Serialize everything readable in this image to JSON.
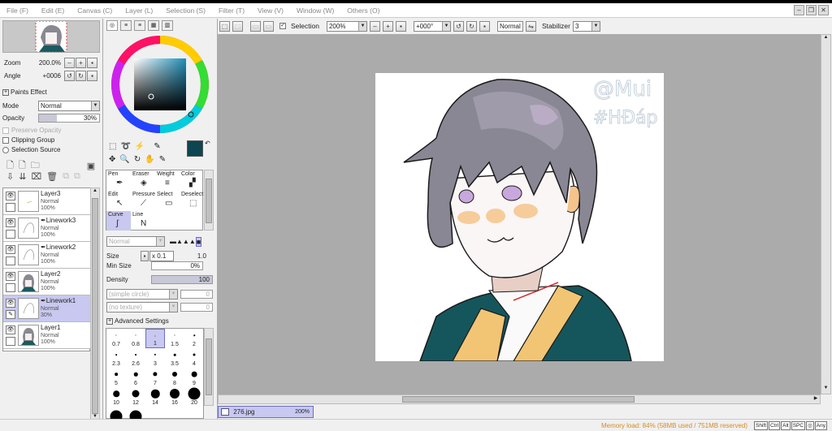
{
  "menu": [
    "File (F)",
    "Edit (E)",
    "Canvas (C)",
    "Layer (L)",
    "Selection (S)",
    "Filter (T)",
    "View (V)",
    "Window (W)",
    "Others (O)"
  ],
  "toolbar": {
    "selection_label": "Selection",
    "zoom": "200%",
    "angle": "+000°",
    "blend": "Normal",
    "stabilizer_label": "Stabilizer",
    "stabilizer_value": "3"
  },
  "navigator": {
    "zoom_label": "Zoom",
    "zoom_value": "200.0%",
    "angle_label": "Angle",
    "angle_value": "+0006"
  },
  "layer_props": {
    "paints_effect": "Paints Effect",
    "mode_label": "Mode",
    "mode_value": "Normal",
    "opacity_label": "Opacity",
    "opacity_value": "30%",
    "opacity_fraction": 0.3,
    "preserve_opacity": "Preserve Opacity",
    "clipping_group": "Clipping Group",
    "selection_source": "Selection Source"
  },
  "layers": [
    {
      "name": "Layer3",
      "mode": "Normal",
      "opacity": "100%",
      "linework": false,
      "active": false
    },
    {
      "name": "Linework3",
      "mode": "Normal",
      "opacity": "100%",
      "linework": true,
      "active": false
    },
    {
      "name": "Linework2",
      "mode": "Normal",
      "opacity": "100%",
      "linework": true,
      "active": false
    },
    {
      "name": "Layer2",
      "mode": "Normal",
      "opacity": "100%",
      "linework": false,
      "active": false
    },
    {
      "name": "Linework1",
      "mode": "Normal",
      "opacity": "30%",
      "linework": true,
      "active": true
    },
    {
      "name": "Layer1",
      "mode": "Normal",
      "opacity": "100%",
      "linework": false,
      "active": false
    }
  ],
  "tools": [
    {
      "label": "Pen",
      "icon": "pen-icon"
    },
    {
      "label": "Eraser",
      "icon": "eraser-icon"
    },
    {
      "label": "Weight",
      "icon": "weight-icon"
    },
    {
      "label": "Color",
      "icon": "color-icon"
    },
    {
      "label": "Edit",
      "icon": "edit-icon"
    },
    {
      "label": "Pressure",
      "icon": "pressure-icon"
    },
    {
      "label": "Select",
      "icon": "select-icon"
    },
    {
      "label": "Deselect",
      "icon": "deselect-icon"
    },
    {
      "label": "Curve",
      "icon": "curve-icon"
    },
    {
      "label": "Line",
      "icon": "line-icon"
    }
  ],
  "brush": {
    "blend": "Normal",
    "size_label": "Size",
    "size_mult": "x 0.1",
    "size_value": "1.0",
    "min_size_label": "Min Size",
    "min_size_value": "0%",
    "density_label": "Density",
    "density_value": "100",
    "shape": "(simple circle)",
    "shape_value": "0",
    "texture": "(no texture)",
    "texture_value": "0",
    "advanced": "Advanced Settings",
    "sizes": [
      "0.7",
      "0.8",
      "1",
      "1.5",
      "2",
      "2.3",
      "2.6",
      "3",
      "3.5",
      "4",
      "5",
      "6",
      "7",
      "8",
      "9",
      "10",
      "12",
      "14",
      "16",
      "20",
      "",
      ""
    ]
  },
  "colors": {
    "primary": "#0d4650",
    "secondary": "#ffffff",
    "accent": "#c8c8f0"
  },
  "canvas": {
    "watermark_line1": "@Mui",
    "watermark_line2": "#HĐáp"
  },
  "file_tab": {
    "name": "276.jpg",
    "zoom": "200%"
  },
  "status": {
    "memory": "Memory load: 84% (58MB used / 751MB reserved)",
    "keys": [
      "Shift",
      "Ctrl",
      "Alt",
      "SPC",
      "◎",
      "Any"
    ]
  }
}
